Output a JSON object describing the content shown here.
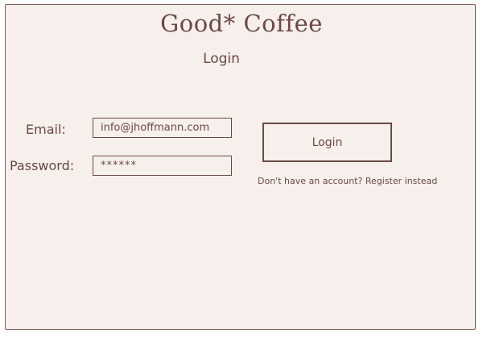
{
  "app": {
    "brand": "Good* Coffee",
    "page_title": "Login"
  },
  "form": {
    "email_label": "Email:",
    "email_value": "info@jhoffmann.com",
    "password_label": "Password:",
    "password_value": "******"
  },
  "actions": {
    "login_label": "Login",
    "register_text": "Don't have an account? Register instead"
  }
}
